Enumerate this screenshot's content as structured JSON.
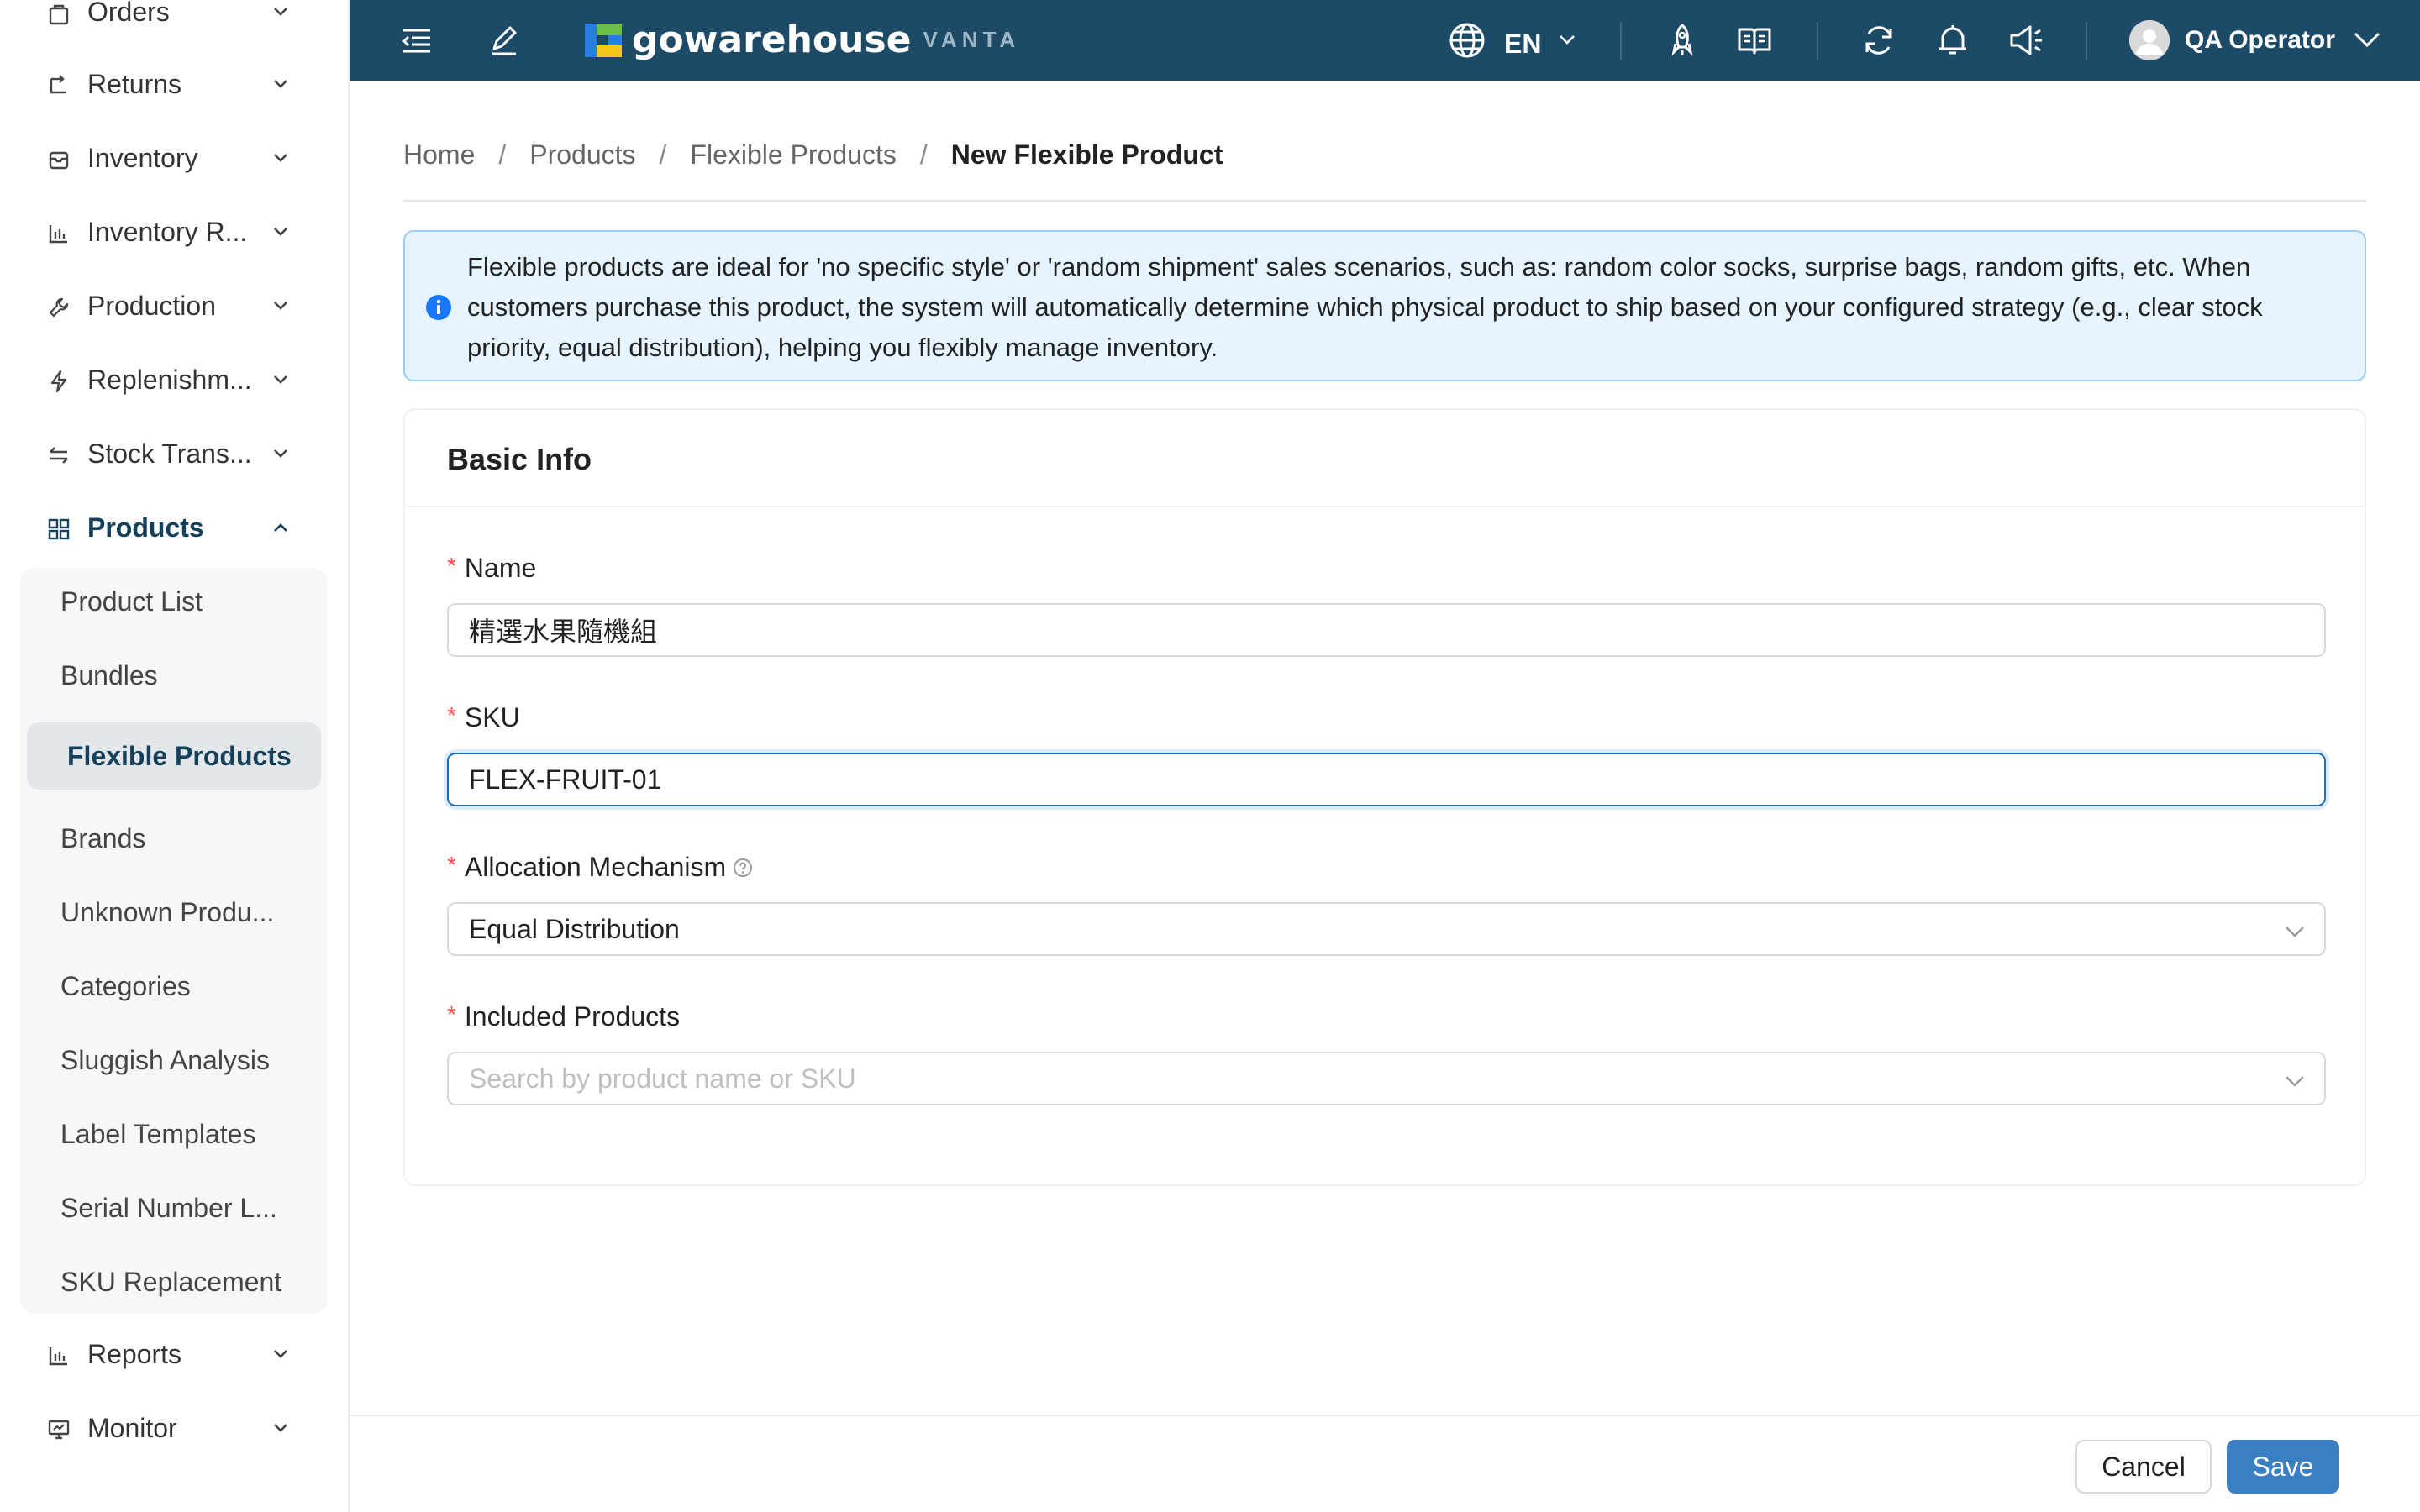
{
  "sidebar": {
    "items": [
      {
        "label": "Orders",
        "icon": "bag-icon"
      },
      {
        "label": "Returns",
        "icon": "return-icon"
      },
      {
        "label": "Inventory",
        "icon": "box-icon"
      },
      {
        "label": "Inventory R...",
        "icon": "bar-chart-icon"
      },
      {
        "label": "Production",
        "icon": "wrench-icon"
      },
      {
        "label": "Replenishm...",
        "icon": "bolt-icon"
      },
      {
        "label": "Stock Trans...",
        "icon": "transfer-icon"
      },
      {
        "label": "Products",
        "icon": "grid-icon"
      },
      {
        "label": "Reports",
        "icon": "bar-chart-icon"
      },
      {
        "label": "Monitor",
        "icon": "monitor-icon"
      }
    ],
    "products_submenu": [
      "Product List",
      "Bundles",
      "Flexible Products",
      "Brands",
      "Unknown Produ...",
      "Categories",
      "Sluggish Analysis",
      "Label Templates",
      "Serial Number L...",
      "SKU Replacement"
    ],
    "active_submenu": "Flexible Products"
  },
  "header": {
    "brand": "gowarehouse",
    "brand_sub": "VANTA",
    "language": "EN",
    "user_name": "QA Operator",
    "colors": {
      "bar": "#1d4a66",
      "logo_blue": "#2a7de1",
      "logo_green": "#6cc04a",
      "logo_yellow": "#f5c518"
    }
  },
  "breadcrumb": [
    "Home",
    "Products",
    "Flexible Products",
    "New Flexible Product"
  ],
  "info": {
    "text": "Flexible products are ideal for 'no specific style' or 'random shipment' sales scenarios, such as: random color socks, surprise bags, random gifts, etc. When customers purchase this product, the system will automatically determine which physical product to ship based on your configured strategy (e.g., clear stock priority, equal distribution), helping you flexibly manage inventory."
  },
  "form": {
    "section_title": "Basic Info",
    "name": {
      "label": "Name",
      "value": "精選水果隨機組"
    },
    "sku": {
      "label": "SKU",
      "value": "FLEX-FRUIT-01"
    },
    "allocation": {
      "label": "Allocation Mechanism",
      "value": "Equal Distribution"
    },
    "included": {
      "label": "Included Products",
      "placeholder": "Search by product name or SKU"
    },
    "required_mark": "*"
  },
  "footer": {
    "cancel_label": "Cancel",
    "save_label": "Save"
  }
}
